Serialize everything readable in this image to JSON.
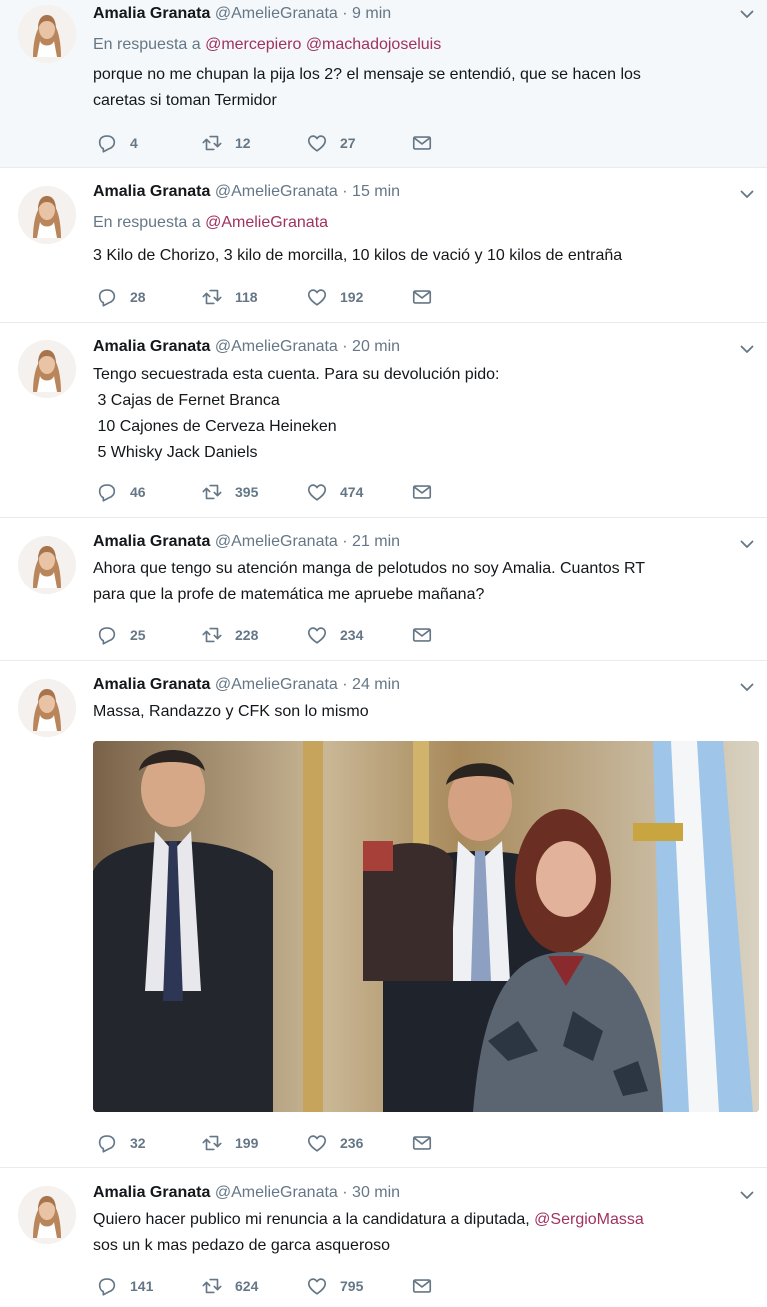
{
  "tweets": [
    {
      "name": "Amalia Granata",
      "handle": "@AmelieGranata",
      "time": "9 min",
      "reply_prefix": "En respuesta a",
      "reply_mentions": [
        "@mercepiero",
        "@machadojoseluis"
      ],
      "lines": [
        "porque no me chupan la pija los 2? el mensaje se entendió, que se hacen los",
        "caretas si toman Termidor"
      ],
      "replies": "4",
      "retweets": "12",
      "likes": "27"
    },
    {
      "name": "Amalia Granata",
      "handle": "@AmelieGranata",
      "time": "15 min",
      "reply_prefix": "En respuesta a",
      "reply_mentions": [
        "@AmelieGranata"
      ],
      "lines": [
        "3 Kilo de Chorizo, 3 kilo de morcilla, 10 kilos de vació y 10 kilos de entraña"
      ],
      "replies": "28",
      "retweets": "118",
      "likes": "192"
    },
    {
      "name": "Amalia Granata",
      "handle": "@AmelieGranata",
      "time": "20 min",
      "lines": [
        "Tengo secuestrada esta cuenta. Para su devolución pido:",
        " 3 Cajas de Fernet Branca",
        " 10 Cajones de Cerveza Heineken",
        " 5 Whisky Jack Daniels"
      ],
      "replies": "46",
      "retweets": "395",
      "likes": "474"
    },
    {
      "name": "Amalia Granata",
      "handle": "@AmelieGranata",
      "time": "21 min",
      "lines": [
        "Ahora que tengo su atención manga de pelotudos no soy Amalia. Cuantos RT",
        "para que la profe de matemática me apruebe mañana?"
      ],
      "replies": "25",
      "retweets": "228",
      "likes": "234"
    },
    {
      "name": "Amalia Granata",
      "handle": "@AmelieGranata",
      "time": "24 min",
      "lines": [
        "Massa, Randazzo y CFK son lo mismo"
      ],
      "replies": "32",
      "retweets": "199",
      "likes": "236"
    },
    {
      "name": "Amalia Granata",
      "handle": "@AmelieGranata",
      "time": "30 min",
      "lines": [
        "Quiero hacer publico mi renuncia a la candidatura a diputada, ",
        "sos un k mas pedazo de garca asqueroso"
      ],
      "line_mention": "@SergioMassa",
      "replies": "141",
      "retweets": "624",
      "likes": "795"
    }
  ],
  "separator": "·",
  "icons": [
    "reply-icon",
    "retweet-icon",
    "like-icon",
    "direct-message-icon",
    "chevron-down-icon"
  ],
  "colors": {
    "mention": "#a0325f",
    "meta": "#657786",
    "highlight_bg": "#f5f8fa"
  }
}
